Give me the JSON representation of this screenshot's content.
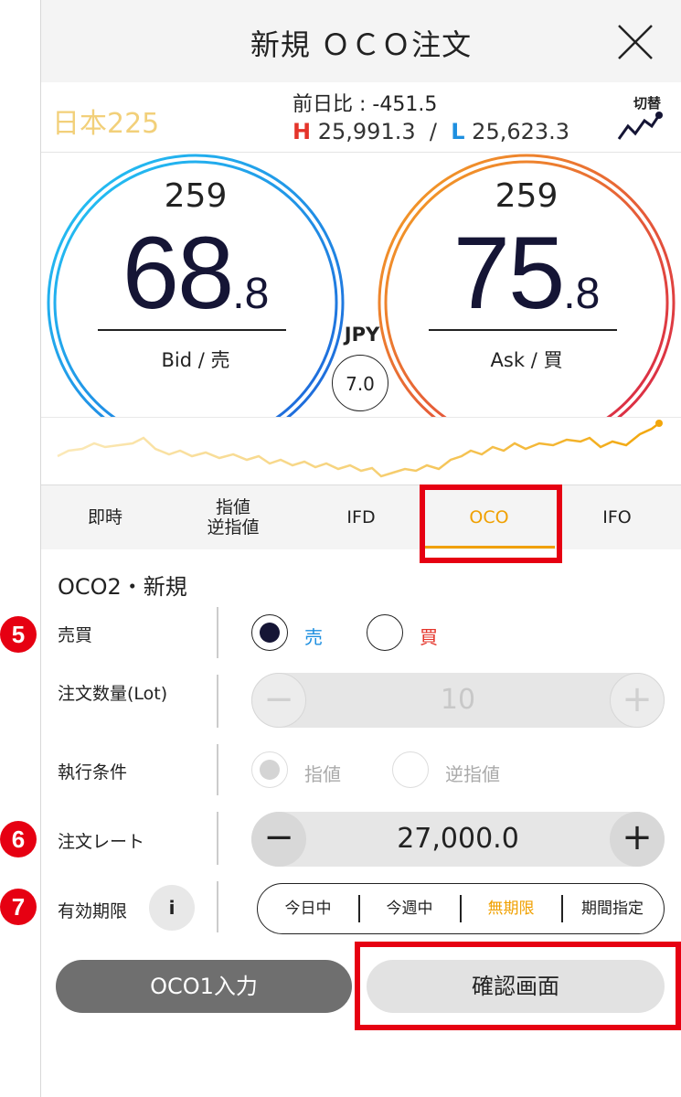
{
  "header": {
    "title": "新規 ＯＣＯ注文"
  },
  "instrument": {
    "name": "日本225",
    "change_label": "前日比 : -451.5",
    "high_letter": "H",
    "high_value": "25,991.3",
    "hl_separator": "/",
    "low_letter": "L",
    "low_value": "25,623.3",
    "switch_label": "切替"
  },
  "bid": {
    "prefix": "259",
    "main": "68",
    "fraction": ".8",
    "label": "Bid / 売"
  },
  "ask": {
    "prefix": "259",
    "main": "75",
    "fraction": ".8",
    "label": "Ask / 買"
  },
  "spread": {
    "currency": "JPY",
    "value": "7.0"
  },
  "tabs": [
    {
      "label_line1": "即時",
      "label_line2": ""
    },
    {
      "label_line1": "指値",
      "label_line2": "逆指値"
    },
    {
      "label_line1": "IFD",
      "label_line2": ""
    },
    {
      "label_line1": "OCO",
      "label_line2": ""
    },
    {
      "label_line1": "IFO",
      "label_line2": ""
    }
  ],
  "form": {
    "title": "OCO2・新規",
    "side": {
      "label": "売買",
      "options": [
        "売",
        "買"
      ],
      "selected": "売"
    },
    "quantity": {
      "label": "注文数量(Lot)",
      "value": "10"
    },
    "execution": {
      "label": "執行条件",
      "options": [
        "指値",
        "逆指値"
      ],
      "selected": "指値"
    },
    "rate": {
      "label": "注文レート",
      "value": "27,000.0"
    },
    "expiry": {
      "label": "有効期限",
      "info": "i",
      "options": [
        "今日中",
        "今週中",
        "無期限",
        "期間指定"
      ],
      "selected": "無期限"
    }
  },
  "buttons": {
    "oco1": "OCO1入力",
    "confirm": "確認画面"
  },
  "steps": {
    "side": "5",
    "rate": "6",
    "expiry": "7"
  },
  "colors": {
    "accent": "#f0a000",
    "highlight": "#e60012",
    "sell": "#1e8fe0",
    "buy": "#e4342a"
  }
}
